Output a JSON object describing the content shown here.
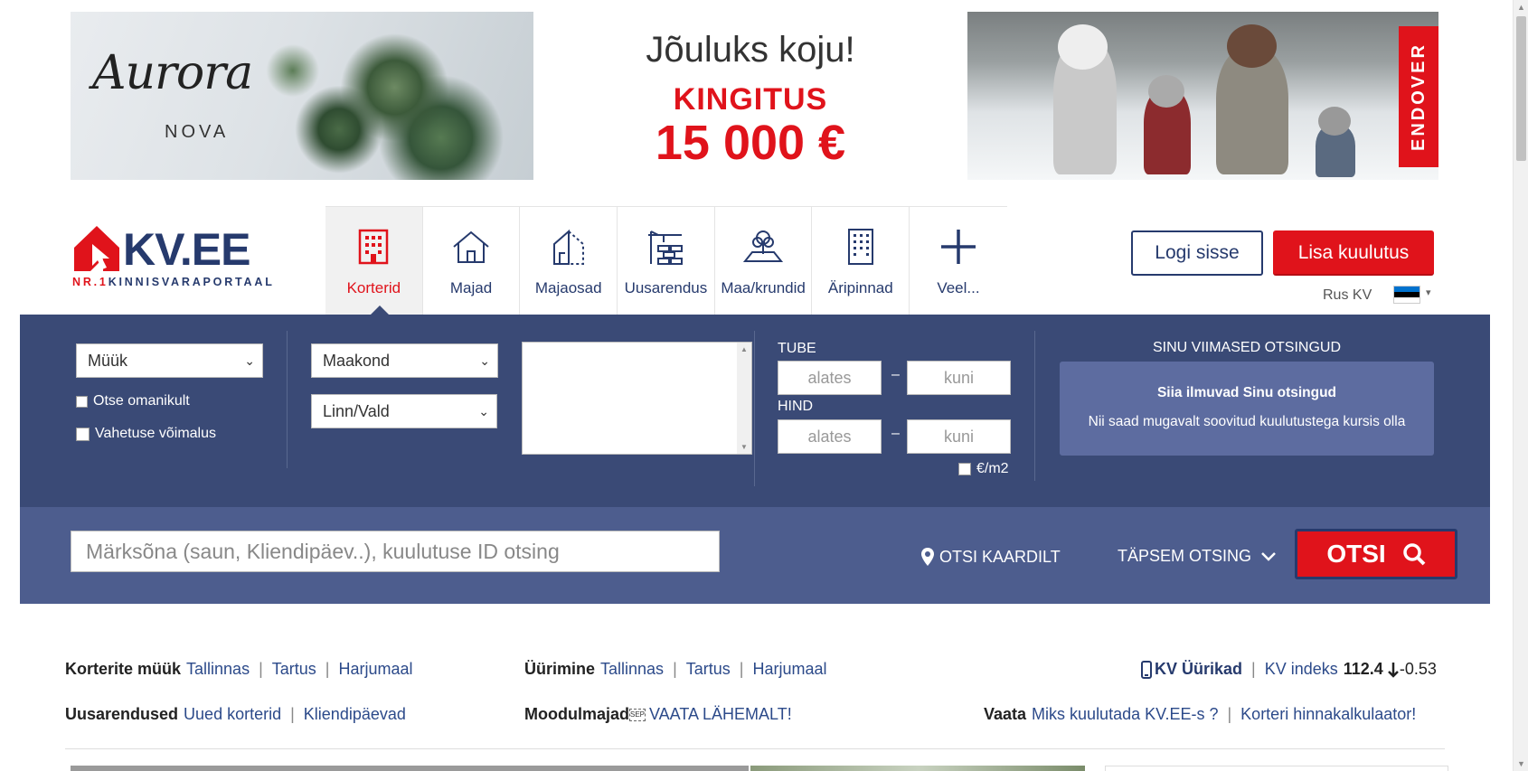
{
  "banner": {
    "brand": "Aurora",
    "brand_sub": "NOVA",
    "headline": "Jõuluks koju!",
    "gift_label": "KINGITUS",
    "gift_amount": "15 000 €",
    "sponsor": "ENDOVER"
  },
  "logo": {
    "text": "KV.EE",
    "sub_red": "NR.1",
    "sub": "KINNISVARAPORTAAL"
  },
  "nav": {
    "items": [
      {
        "label": "Korterid",
        "icon": "apartment-building-icon",
        "active": true
      },
      {
        "label": "Majad",
        "icon": "house-icon",
        "active": false
      },
      {
        "label": "Majaosad",
        "icon": "house-part-icon",
        "active": false
      },
      {
        "label": "Uusarendus",
        "icon": "crane-bricks-icon",
        "active": false
      },
      {
        "label": "Maa/krundid",
        "icon": "land-tree-icon",
        "active": false
      },
      {
        "label": "Äripinnad",
        "icon": "office-building-icon",
        "active": false
      },
      {
        "label": "Veel...",
        "icon": "plus-icon",
        "active": false
      }
    ]
  },
  "header": {
    "login": "Logi sisse",
    "add_listing": "Lisa kuulutus",
    "lang": "Rus KV",
    "flag": "estonia-flag"
  },
  "search": {
    "deal_type": "Müük",
    "county": "Maakond",
    "city": "Linn/Vald",
    "owner_checkbox": "Otse omanikult",
    "exchange_checkbox": "Vahetuse võimalus",
    "rooms_label": "TUBE",
    "price_label": "HIND",
    "from_placeholder": "alates",
    "to_placeholder": "kuni",
    "per_m2": "€/m2",
    "recent_title": "SINU VIIMASED OTSINGUD",
    "recent_bold": "Siia ilmuvad Sinu otsingud",
    "recent_text": "Nii saad mugavalt soovitud kuulutustega kursis olla",
    "keyword_placeholder": "Märksõna (saun, Kliendipäev..), kuulutuse ID otsing",
    "map_search": "OTSI KAARDILT",
    "advanced": "TÄPSEM OTSING",
    "submit": "OTSI"
  },
  "links": {
    "row1": {
      "sale_label": "Korterite müük",
      "sale_links": [
        "Tallinnas",
        "Tartus",
        "Harjumaal"
      ],
      "rent_label": "Üürimine",
      "rent_links": [
        "Tallinnas",
        "Tartus",
        "Harjumaal"
      ],
      "kv_rates": "KV Üürikad",
      "index_label": "KV indeks",
      "index_value": "112.4",
      "index_change": "-0.53"
    },
    "row2": {
      "new_label": "Uusarendused",
      "new_links": [
        "Uued korterid",
        "Kliendipäevad"
      ],
      "modular_label": "Moodulmajad",
      "modular_link": "VAATA LÄHEMALT!",
      "see_label": "Vaata",
      "see_links": [
        "Miks kuulutada KV.EE-s ?",
        "Korteri hinnakalkulaator!"
      ]
    }
  }
}
